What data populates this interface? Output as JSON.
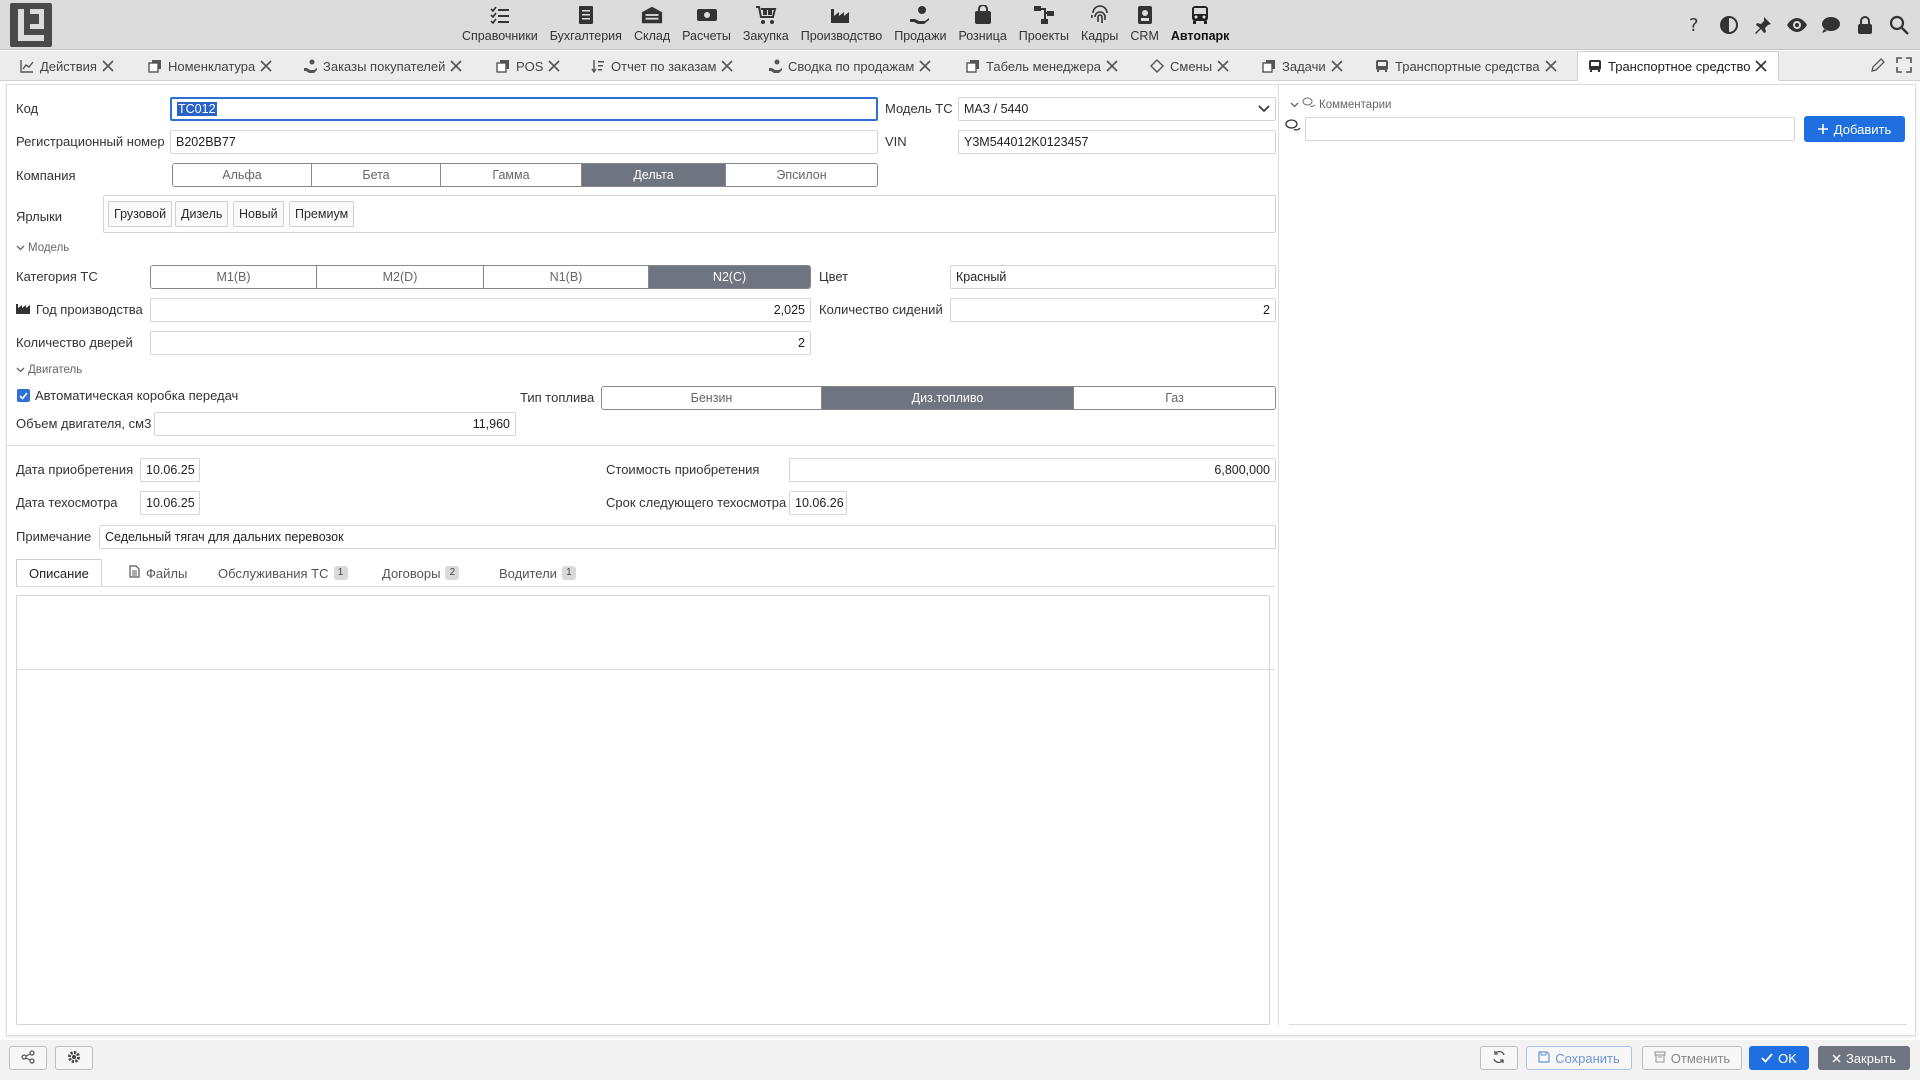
{
  "topnav": {
    "modules": [
      {
        "label": "Справочники",
        "icon": "list-check-icon"
      },
      {
        "label": "Бухгалтерия",
        "icon": "document-icon"
      },
      {
        "label": "Склад",
        "icon": "warehouse-icon"
      },
      {
        "label": "Расчеты",
        "icon": "money-icon"
      },
      {
        "label": "Закупка",
        "icon": "cart-icon"
      },
      {
        "label": "Производство",
        "icon": "factory-icon"
      },
      {
        "label": "Продажи",
        "icon": "hand-money-icon"
      },
      {
        "label": "Розница",
        "icon": "bag-icon"
      },
      {
        "label": "Проекты",
        "icon": "diagram-icon"
      },
      {
        "label": "Кадры",
        "icon": "fingerprint-icon"
      },
      {
        "label": "CRM",
        "icon": "contact-card-icon"
      },
      {
        "label": "Автопарк",
        "icon": "bus-icon",
        "active": true
      }
    ],
    "right_icons": [
      "help-icon",
      "contrast-icon",
      "pin-icon",
      "eye-icon",
      "chat-icon",
      "lock-icon",
      "search-icon"
    ]
  },
  "tabs": [
    {
      "label": "Действия"
    },
    {
      "label": "Номенклатура"
    },
    {
      "label": "Заказы покупателей"
    },
    {
      "label": "POS"
    },
    {
      "label": "Отчет по заказам"
    },
    {
      "label": "Сводка по продажам"
    },
    {
      "label": "Табель менеджера"
    },
    {
      "label": "Смены"
    },
    {
      "label": "Задачи"
    },
    {
      "label": "Транспортные средства"
    },
    {
      "label": "Транспортное средство",
      "active": true
    }
  ],
  "form": {
    "code_label": "Код",
    "code_value": "ТС012",
    "model_label": "Модель ТС",
    "model_value": "МАЗ / 5440",
    "reg_label": "Регистрационный номер",
    "reg_value": "В202ВВ77",
    "vin_label": "VIN",
    "vin_value": "Y3M544012K0123457",
    "company_label": "Компания",
    "company_options": [
      "Альфа",
      "Бета",
      "Гамма",
      "Дельта",
      "Эпсилон"
    ],
    "company_selected": "Дельта",
    "tags_label": "Ярлыки",
    "tags": [
      "Грузовой",
      "Дизель",
      "Новый",
      "Премиум"
    ],
    "section_model": "Модель",
    "category_label": "Категория ТС",
    "category_options": [
      "M1(B)",
      "M2(D)",
      "N1(B)",
      "N2(C)"
    ],
    "category_selected": "N2(C)",
    "color_label": "Цвет",
    "color_value": "Красный",
    "year_label": "Год производства",
    "year_value": "2,025",
    "seats_label": "Количество сидений",
    "seats_value": "2",
    "doors_label": "Количество дверей",
    "doors_value": "2",
    "section_engine": "Двигатель",
    "auto_gear_label": "Автоматическая коробка передач",
    "auto_gear_checked": true,
    "fuel_label": "Тип топлива",
    "fuel_options": [
      "Бензин",
      "Диз.топливо",
      "Газ"
    ],
    "fuel_selected": "Диз.топливо",
    "engine_volume_label": "Объем двигателя, см3",
    "engine_volume_value": "11,960",
    "purchase_date_label": "Дата приобретения",
    "purchase_date_value": "10.06.25",
    "purchase_cost_label": "Стоимость приобретения",
    "purchase_cost_value": "6,800,000",
    "inspection_date_label": "Дата техосмотра",
    "inspection_date_value": "10.06.25",
    "next_inspection_label": "Срок следующего техосмотра",
    "next_inspection_value": "10.06.26",
    "note_label": "Примечание",
    "note_value": "Седельный тягач для дальних перевозок"
  },
  "subtabs": [
    {
      "label": "Описание",
      "badge": ""
    },
    {
      "label": "Файлы",
      "badge": ""
    },
    {
      "label": "Обслуживания ТС",
      "badge": "1"
    },
    {
      "label": "Договоры",
      "badge": "2"
    },
    {
      "label": "Водители",
      "badge": "1"
    }
  ],
  "comments": {
    "title": "Комментарии",
    "input_value": "",
    "add_label": "Добавить"
  },
  "bottom": {
    "save_label": "Сохранить",
    "cancel_label": "Отменить",
    "ok_label": "OK",
    "close_label": "Закрыть"
  },
  "colors": {
    "accent": "#1f6fe0",
    "segment_selected": "#6e7480",
    "topbar": "#dcdcdc"
  }
}
